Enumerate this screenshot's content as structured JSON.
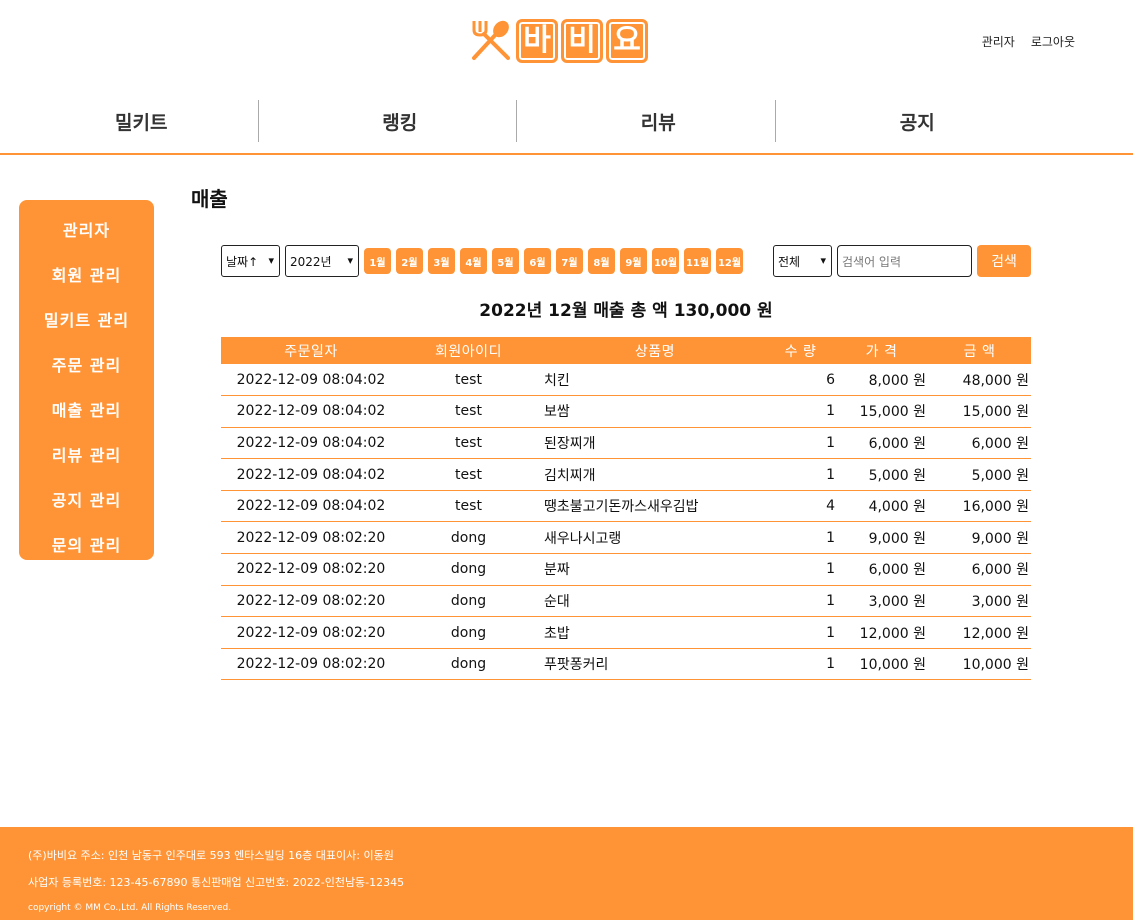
{
  "brand": {
    "logo_chars": [
      "바",
      "비",
      "요"
    ],
    "accent": "#ff9436"
  },
  "top_links": [
    "관리자",
    "로그아웃"
  ],
  "gnb": [
    "밀키트",
    "랭킹",
    "리뷰",
    "공지"
  ],
  "sidebar": {
    "title": "관리자",
    "items": [
      "회원 관리",
      "밀키트 관리",
      "주문 관리",
      "매출 관리",
      "리뷰 관리",
      "공지 관리",
      "문의 관리"
    ]
  },
  "page_title": "매출",
  "toolbar": {
    "sort_select": "날짜↑",
    "year_select": "2022년",
    "months": [
      "1월",
      "2월",
      "3월",
      "4월",
      "5월",
      "6월",
      "7월",
      "8월",
      "9월",
      "10월",
      "11월",
      "12월"
    ],
    "filter_select": "전체",
    "search_placeholder": "검색어 입력",
    "search_button": "검색"
  },
  "summary": "2022년 12월 매출 총 액 130,000 원",
  "table": {
    "headers": [
      "주문일자",
      "회원아이디",
      "상품명",
      "수 량",
      "가 격",
      "금 액"
    ],
    "rows": [
      [
        "2022-12-09 08:04:02",
        "test",
        "치킨",
        "6",
        "8,000 원",
        "48,000 원"
      ],
      [
        "2022-12-09 08:04:02",
        "test",
        "보쌈",
        "1",
        "15,000 원",
        "15,000 원"
      ],
      [
        "2022-12-09 08:04:02",
        "test",
        "된장찌개",
        "1",
        "6,000 원",
        "6,000 원"
      ],
      [
        "2022-12-09 08:04:02",
        "test",
        "김치찌개",
        "1",
        "5,000 원",
        "5,000 원"
      ],
      [
        "2022-12-09 08:04:02",
        "test",
        "땡초불고기돈까스새우김밥",
        "4",
        "4,000 원",
        "16,000 원"
      ],
      [
        "2022-12-09 08:02:20",
        "dong",
        "새우나시고랭",
        "1",
        "9,000 원",
        "9,000 원"
      ],
      [
        "2022-12-09 08:02:20",
        "dong",
        "분짜",
        "1",
        "6,000 원",
        "6,000 원"
      ],
      [
        "2022-12-09 08:02:20",
        "dong",
        "순대",
        "1",
        "3,000 원",
        "3,000 원"
      ],
      [
        "2022-12-09 08:02:20",
        "dong",
        "초밥",
        "1",
        "12,000 원",
        "12,000 원"
      ],
      [
        "2022-12-09 08:02:20",
        "dong",
        "푸팟퐁커리",
        "1",
        "10,000 원",
        "10,000 원"
      ]
    ]
  },
  "footer": {
    "line1": "(주)바비요   주소: 인천 남동구 인주대로 593 엔타스빌딩 16층   대표이사: 이동원",
    "line2": "사업자 등록번호: 123-45-67890   통신판매업 신고번호: 2022-인천남동-12345",
    "line3": "copyright © MM Co.,Ltd. All Rights Reserved."
  }
}
